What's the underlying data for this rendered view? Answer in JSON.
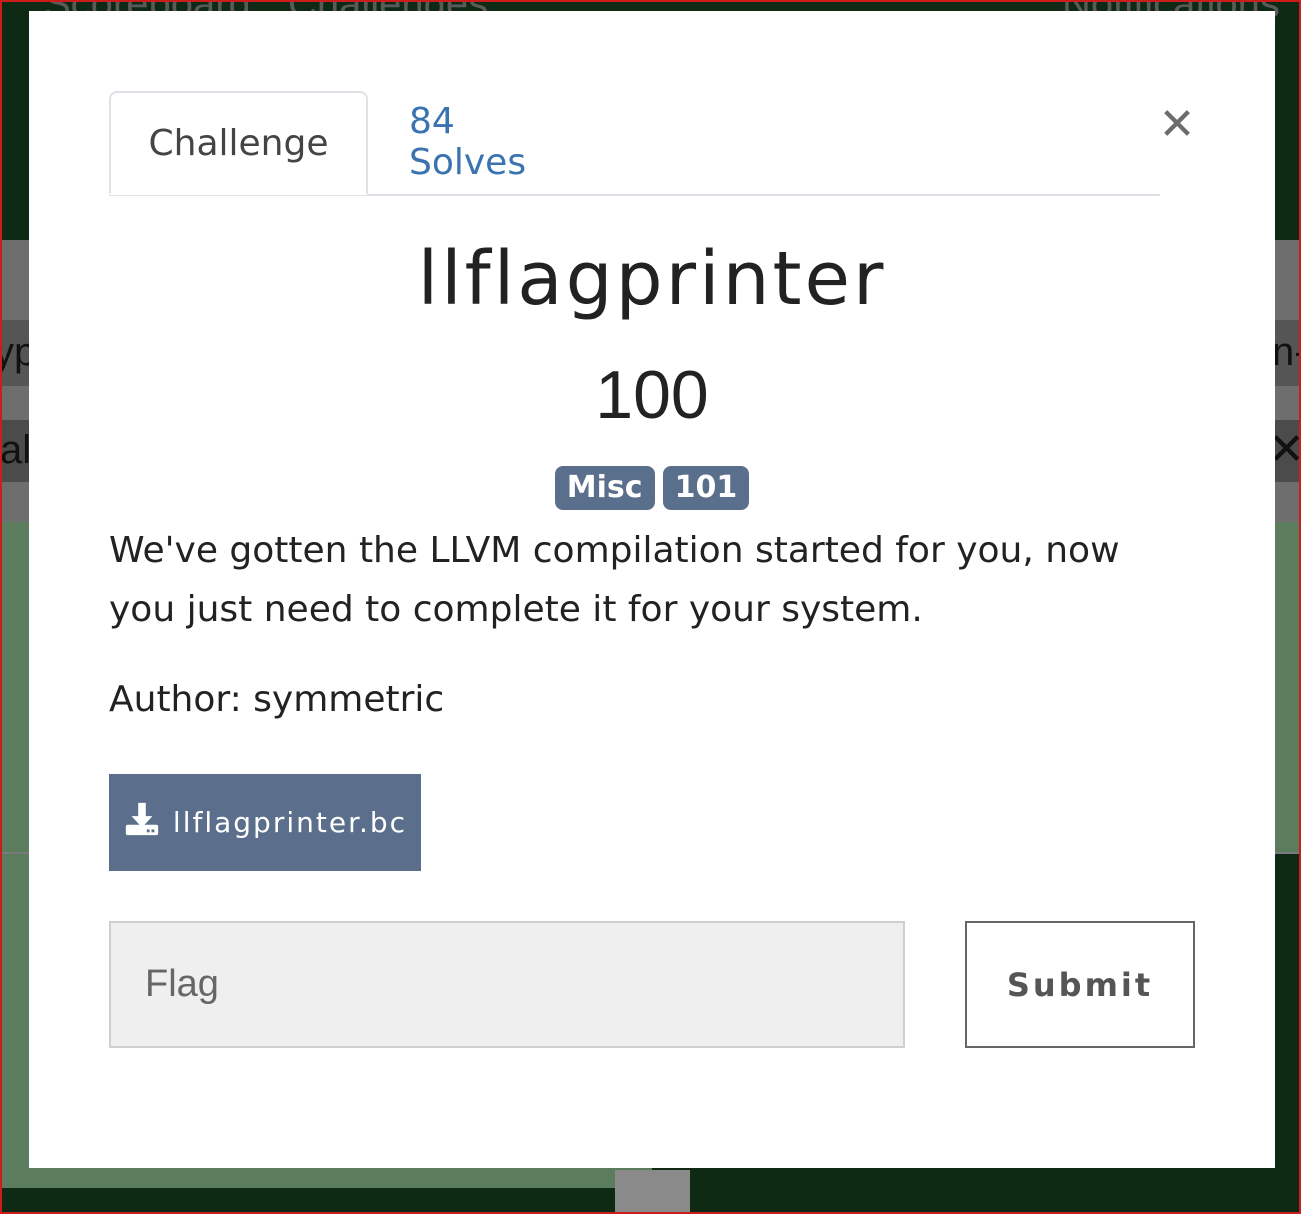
{
  "background": {
    "nav_items": [
      "Scoreboard",
      "Challenges",
      "Notifications"
    ],
    "band_left_1": "yp",
    "band_right_1": "n-",
    "band_left_2": "al",
    "band_right_2": "✕"
  },
  "modal": {
    "tabs": [
      {
        "label": "Challenge",
        "active": true
      },
      {
        "label": "84 Solves",
        "active": false
      }
    ],
    "close_glyph": "✕",
    "title": "llflagprinter",
    "points": "100",
    "tags": [
      "Misc",
      "101"
    ],
    "description": "We've gotten the LLVM compilation started for you, now you just need to complete it for your system.",
    "author": "Author: symmetric",
    "file": {
      "label": "llflagprinter.bc",
      "icon": "download-icon"
    },
    "flag_input": {
      "placeholder": "Flag",
      "value": ""
    },
    "submit_label": "Submit"
  },
  "colors": {
    "tag_bg": "#5a6f8c",
    "file_button_bg": "#5b6f8c",
    "tab_link": "#3a73b0",
    "frame_red": "#cc1d1d"
  }
}
